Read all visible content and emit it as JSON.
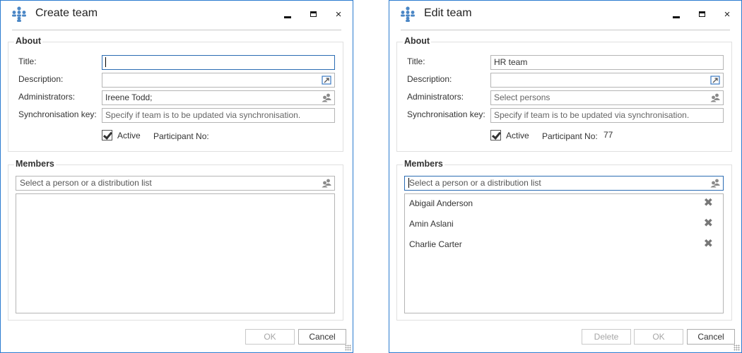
{
  "windows": {
    "create": {
      "title": "Create team",
      "icon": "team-icon",
      "controls": {
        "minimize": "minimize-icon",
        "maximize": "maximize-icon",
        "close": "×"
      },
      "about": {
        "legend": "About",
        "title_label": "Title:",
        "title_value": "",
        "description_label": "Description:",
        "description_value": "",
        "administrators_label": "Administrators:",
        "administrators_value": "Ireene Todd;",
        "sync_label": "Synchronisation key:",
        "sync_placeholder": "Specify if team is to be updated via synchronisation.",
        "active_label": "Active",
        "active_checked": true,
        "participant_label": "Participant No:",
        "participant_value": ""
      },
      "members": {
        "legend": "Members",
        "search_placeholder": "Select a person or a distribution list",
        "items": []
      },
      "buttons": {
        "ok": "OK",
        "cancel": "Cancel"
      }
    },
    "edit": {
      "title": "Edit team",
      "icon": "team-icon",
      "controls": {
        "minimize": "minimize-icon",
        "maximize": "maximize-icon",
        "close": "×"
      },
      "about": {
        "legend": "About",
        "title_label": "Title:",
        "title_value": "HR team",
        "description_label": "Description:",
        "description_value": "",
        "administrators_label": "Administrators:",
        "administrators_placeholder": "Select persons",
        "sync_label": "Synchronisation key:",
        "sync_placeholder": "Specify if team is to be updated via synchronisation.",
        "active_label": "Active",
        "active_checked": true,
        "participant_label": "Participant No:",
        "participant_value": "77"
      },
      "members": {
        "legend": "Members",
        "search_placeholder": "Select a person or a distribution list",
        "items": [
          {
            "name": "Abigail Anderson",
            "remove": "✖"
          },
          {
            "name": "Amin Aslani",
            "remove": "✖"
          },
          {
            "name": "Charlie Carter",
            "remove": "✖"
          }
        ]
      },
      "buttons": {
        "delete": "Delete",
        "ok": "OK",
        "cancel": "Cancel"
      }
    }
  },
  "colors": {
    "window_border": "#2b7bd0",
    "focus_border": "#2b6cb3",
    "icon_blue": "#4a86c5"
  }
}
